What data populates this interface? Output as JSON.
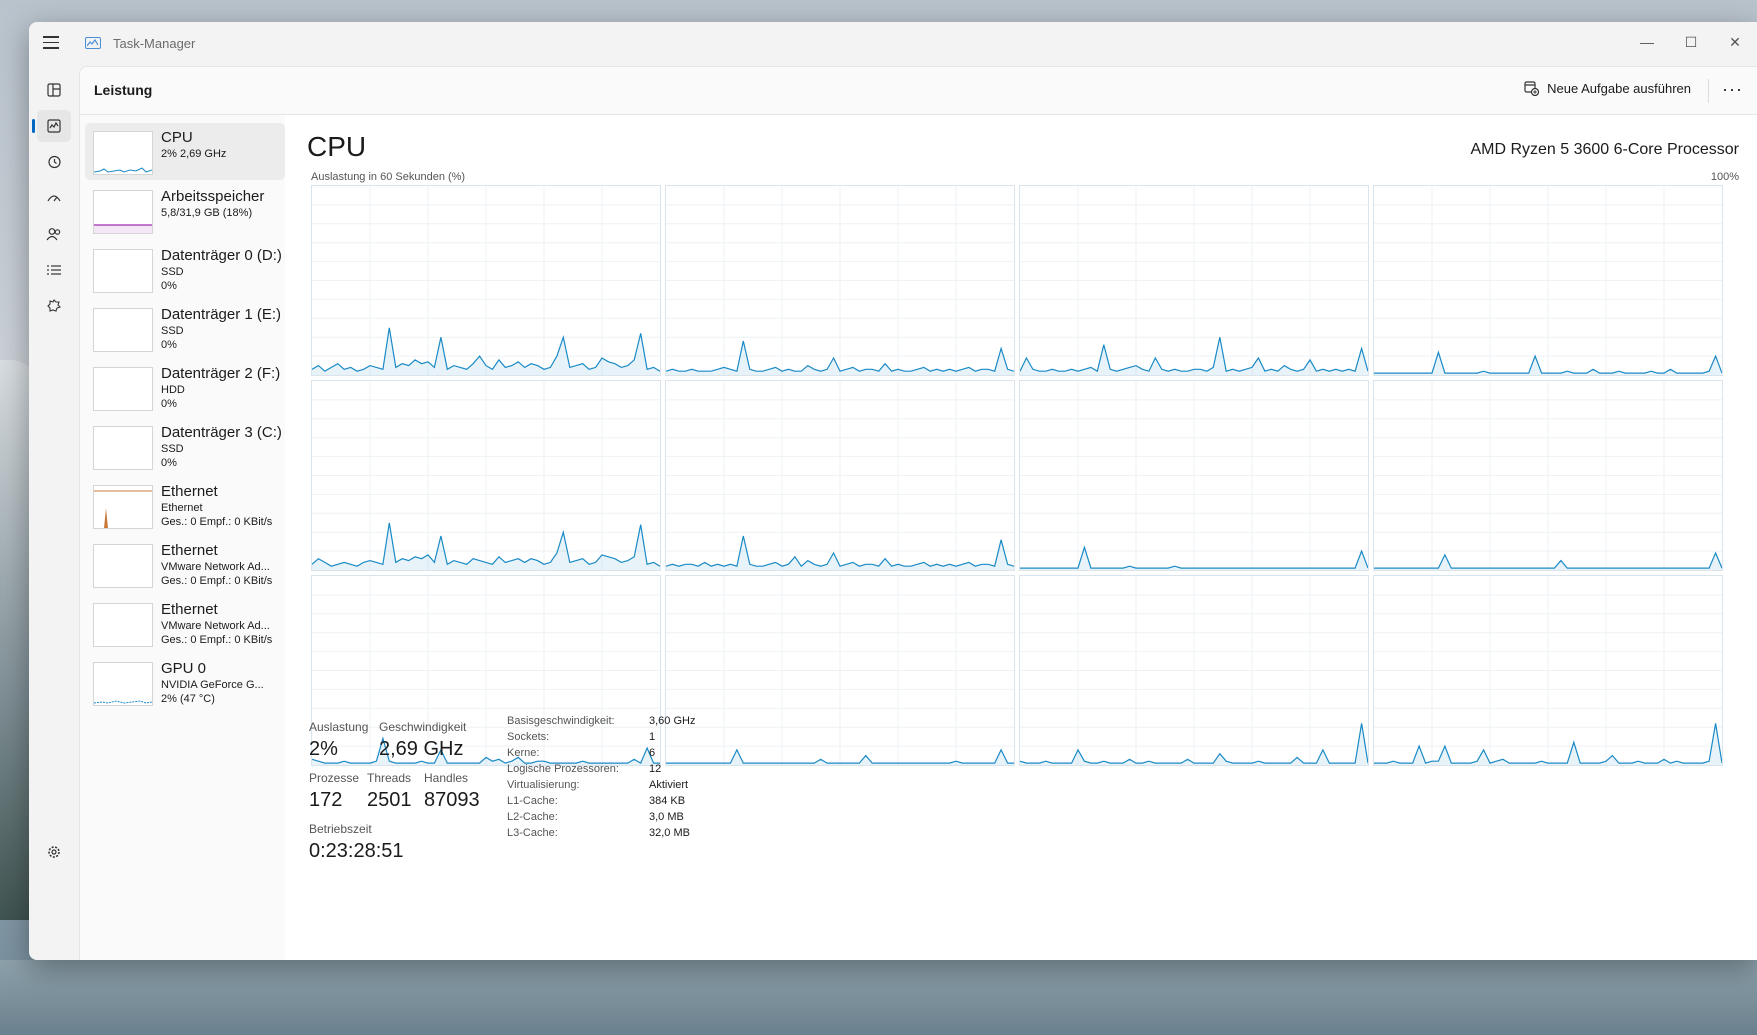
{
  "app": {
    "title": "Task-Manager"
  },
  "window_controls": {
    "minimize": "—",
    "maximize": "☐",
    "close": "✕"
  },
  "header": {
    "title": "Leistung",
    "new_task_label": "Neue Aufgabe ausführen",
    "more": "···"
  },
  "rail": [
    "processes-icon",
    "performance-icon",
    "history-icon",
    "startup-icon",
    "users-icon",
    "details-icon",
    "services-icon",
    "settings-icon"
  ],
  "sidebar": [
    {
      "title": "CPU",
      "lines": [
        "2% 2,69 GHz"
      ]
    },
    {
      "title": "Arbeitsspeicher",
      "lines": [
        "5,8/31,9 GB (18%)"
      ]
    },
    {
      "title": "Datenträger 0 (D:)",
      "lines": [
        "SSD",
        "0%"
      ]
    },
    {
      "title": "Datenträger 1 (E:)",
      "lines": [
        "SSD",
        "0%"
      ]
    },
    {
      "title": "Datenträger 2 (F:)",
      "lines": [
        "HDD",
        "0%"
      ]
    },
    {
      "title": "Datenträger 3 (C:)",
      "lines": [
        "SSD",
        "0%"
      ]
    },
    {
      "title": "Ethernet",
      "lines": [
        "Ethernet",
        "Ges.: 0 Empf.: 0 KBit/s"
      ]
    },
    {
      "title": "Ethernet",
      "lines": [
        "VMware Network Ad...",
        "Ges.: 0 Empf.: 0 KBit/s"
      ]
    },
    {
      "title": "Ethernet",
      "lines": [
        "VMware Network Ad...",
        "Ges.: 0 Empf.: 0 KBit/s"
      ]
    },
    {
      "title": "GPU 0",
      "lines": [
        "NVIDIA GeForce G...",
        "2% (47 °C)"
      ]
    }
  ],
  "main": {
    "title": "CPU",
    "model": "AMD Ryzen 5 3600 6-Core Processor",
    "util_label": "Auslastung in 60 Sekunden (%)",
    "util_max": "100%",
    "line_color": "#1a8ac6"
  },
  "stats": {
    "auslastung_label": "Auslastung",
    "auslastung": "2%",
    "geschwindigkeit_label": "Geschwindigkeit",
    "geschwindigkeit": "2,69 GHz",
    "prozesse_label": "Prozesse",
    "prozesse": "172",
    "threads_label": "Threads",
    "threads": "2501",
    "handles_label": "Handles",
    "handles": "87093",
    "betriebszeit_label": "Betriebszeit",
    "betriebszeit": "0:23:28:51"
  },
  "details": [
    {
      "k": "Basisgeschwindigkeit:",
      "v": "3,60 GHz"
    },
    {
      "k": "Sockets:",
      "v": "1"
    },
    {
      "k": "Kerne:",
      "v": "6"
    },
    {
      "k": "Logische Prozessoren:",
      "v": "12"
    },
    {
      "k": "Virtualisierung:",
      "v": "Aktiviert"
    },
    {
      "k": "L1-Cache:",
      "v": "384 KB"
    },
    {
      "k": "L2-Cache:",
      "v": "3,0 MB"
    },
    {
      "k": "L3-Cache:",
      "v": "32,0 MB"
    }
  ],
  "chart_data": {
    "type": "line",
    "title": "Auslastung in 60 Sekunden (%)",
    "ylim": [
      0,
      100
    ],
    "series": [
      {
        "values": [
          3,
          5,
          2,
          4,
          6,
          3,
          4,
          2,
          3,
          5,
          4,
          3,
          25,
          4,
          6,
          5,
          8,
          6,
          7,
          4,
          20,
          3,
          5,
          4,
          3,
          6,
          10,
          5,
          3,
          8,
          4,
          5,
          7,
          4,
          6,
          5,
          3,
          4,
          10,
          20,
          4,
          5,
          6,
          3,
          4,
          9,
          7,
          6,
          4,
          5,
          8,
          22,
          3,
          4,
          2
        ]
      },
      {
        "values": [
          2,
          3,
          2,
          2,
          3,
          2,
          2,
          2,
          3,
          4,
          3,
          2,
          18,
          3,
          2,
          2,
          3,
          4,
          2,
          3,
          2,
          2,
          5,
          3,
          2,
          3,
          9,
          2,
          3,
          4,
          2,
          3,
          3,
          2,
          6,
          2,
          3,
          2,
          2,
          3,
          4,
          2,
          3,
          2,
          3,
          2,
          3,
          4,
          2,
          3,
          3,
          2,
          14,
          3,
          2
        ]
      },
      {
        "values": [
          2,
          9,
          3,
          2,
          2,
          3,
          2,
          2,
          3,
          2,
          3,
          4,
          2,
          16,
          3,
          2,
          3,
          4,
          5,
          3,
          2,
          9,
          3,
          2,
          3,
          2,
          2,
          3,
          3,
          2,
          4,
          20,
          2,
          3,
          2,
          3,
          4,
          9,
          2,
          3,
          2,
          5,
          3,
          2,
          3,
          8,
          2,
          3,
          2,
          3,
          2,
          3,
          2,
          14,
          2
        ]
      },
      {
        "values": [
          1,
          1,
          1,
          1,
          1,
          1,
          1,
          1,
          1,
          1,
          12,
          1,
          1,
          1,
          1,
          1,
          1,
          2,
          1,
          1,
          1,
          1,
          1,
          1,
          1,
          10,
          1,
          1,
          1,
          1,
          2,
          1,
          1,
          1,
          3,
          1,
          1,
          1,
          2,
          1,
          1,
          1,
          1,
          2,
          1,
          1,
          3,
          1,
          1,
          1,
          1,
          1,
          2,
          10,
          1
        ]
      },
      {
        "values": [
          3,
          6,
          4,
          2,
          3,
          4,
          3,
          2,
          4,
          5,
          4,
          3,
          25,
          4,
          6,
          5,
          7,
          6,
          8,
          4,
          18,
          3,
          5,
          4,
          3,
          6,
          5,
          4,
          3,
          7,
          4,
          5,
          6,
          4,
          6,
          5,
          3,
          4,
          9,
          20,
          4,
          5,
          6,
          3,
          4,
          8,
          7,
          6,
          4,
          5,
          7,
          24,
          3,
          4,
          2
        ]
      },
      {
        "values": [
          2,
          3,
          2,
          3,
          3,
          2,
          4,
          2,
          3,
          2,
          3,
          2,
          18,
          3,
          2,
          2,
          3,
          4,
          2,
          3,
          7,
          2,
          5,
          3,
          2,
          3,
          9,
          2,
          3,
          4,
          2,
          3,
          3,
          2,
          6,
          2,
          3,
          2,
          2,
          3,
          4,
          2,
          3,
          2,
          3,
          2,
          3,
          4,
          2,
          3,
          3,
          2,
          16,
          3,
          2
        ]
      },
      {
        "values": [
          1,
          1,
          1,
          1,
          1,
          1,
          1,
          1,
          1,
          1,
          12,
          1,
          1,
          1,
          1,
          1,
          1,
          2,
          1,
          1,
          1,
          1,
          1,
          1,
          2,
          1,
          1,
          1,
          1,
          1,
          1,
          1,
          1,
          1,
          1,
          1,
          1,
          1,
          1,
          1,
          1,
          1,
          1,
          1,
          1,
          1,
          1,
          1,
          1,
          1,
          1,
          1,
          1,
          10,
          1
        ]
      },
      {
        "values": [
          1,
          1,
          1,
          1,
          1,
          1,
          1,
          1,
          1,
          1,
          1,
          8,
          1,
          1,
          1,
          1,
          1,
          1,
          1,
          1,
          1,
          1,
          1,
          1,
          1,
          1,
          1,
          1,
          1,
          5,
          1,
          1,
          1,
          1,
          1,
          1,
          1,
          1,
          1,
          1,
          1,
          1,
          1,
          1,
          1,
          1,
          1,
          1,
          1,
          1,
          1,
          1,
          1,
          9,
          1
        ]
      },
      {
        "values": [
          3,
          2,
          1,
          1,
          1,
          2,
          1,
          1,
          1,
          1,
          2,
          14,
          2,
          1,
          1,
          1,
          1,
          2,
          1,
          1,
          8,
          1,
          1,
          1,
          1,
          1,
          1,
          4,
          2,
          3,
          1,
          2,
          4,
          1,
          1,
          2,
          2,
          1,
          1,
          1,
          1,
          1,
          2,
          1,
          1,
          1,
          1,
          1,
          1,
          1,
          3,
          1,
          9,
          1,
          1
        ]
      },
      {
        "values": [
          1,
          1,
          1,
          1,
          1,
          1,
          1,
          1,
          1,
          1,
          1,
          8,
          1,
          1,
          1,
          1,
          1,
          1,
          1,
          1,
          1,
          1,
          1,
          1,
          3,
          1,
          1,
          1,
          1,
          1,
          1,
          5,
          1,
          1,
          1,
          1,
          1,
          1,
          1,
          1,
          1,
          1,
          1,
          1,
          1,
          2,
          1,
          1,
          1,
          1,
          1,
          1,
          8,
          1,
          1
        ]
      },
      {
        "values": [
          2,
          1,
          1,
          1,
          2,
          1,
          1,
          1,
          1,
          8,
          2,
          1,
          1,
          2,
          1,
          1,
          1,
          3,
          1,
          1,
          2,
          1,
          1,
          1,
          1,
          1,
          3,
          1,
          1,
          1,
          1,
          6,
          2,
          1,
          1,
          1,
          1,
          2,
          1,
          1,
          1,
          1,
          1,
          4,
          1,
          1,
          1,
          8,
          1,
          1,
          1,
          1,
          1,
          22,
          1
        ]
      },
      {
        "values": [
          1,
          1,
          1,
          2,
          1,
          1,
          1,
          10,
          1,
          2,
          2,
          10,
          1,
          1,
          1,
          1,
          2,
          8,
          1,
          2,
          3,
          1,
          1,
          1,
          1,
          1,
          2,
          1,
          1,
          1,
          1,
          12,
          1,
          1,
          1,
          1,
          2,
          5,
          1,
          1,
          1,
          2,
          1,
          1,
          1,
          3,
          1,
          2,
          1,
          1,
          1,
          1,
          2,
          22,
          1
        ]
      }
    ]
  }
}
